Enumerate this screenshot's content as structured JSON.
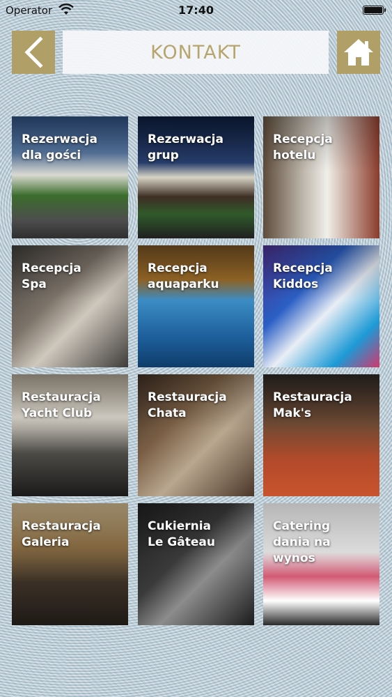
{
  "status_bar": {
    "carrier": "Operator",
    "time": "17:40"
  },
  "header": {
    "title": "KONTAKT",
    "back_icon": "chevron-left-icon",
    "home_icon": "home-icon",
    "accent_color": "#b19f68"
  },
  "tiles": [
    {
      "label": "Rezerwacja\ndla gości"
    },
    {
      "label": "Rezerwacja\ngrup"
    },
    {
      "label": "Recepcja\nhotelu"
    },
    {
      "label": "Recepcja\nSpa"
    },
    {
      "label": "Recepcja\naquaparku"
    },
    {
      "label": "Recepcja\nKiddos"
    },
    {
      "label": "Restauracja\nYacht Club"
    },
    {
      "label": "Restauracja\nChata"
    },
    {
      "label": "Restauracja\nMak's"
    },
    {
      "label": "Restauracja\nGaleria"
    },
    {
      "label": "Cukiernia\nLe Gâteau"
    },
    {
      "label": "Catering\ndania na\nwynos"
    }
  ]
}
